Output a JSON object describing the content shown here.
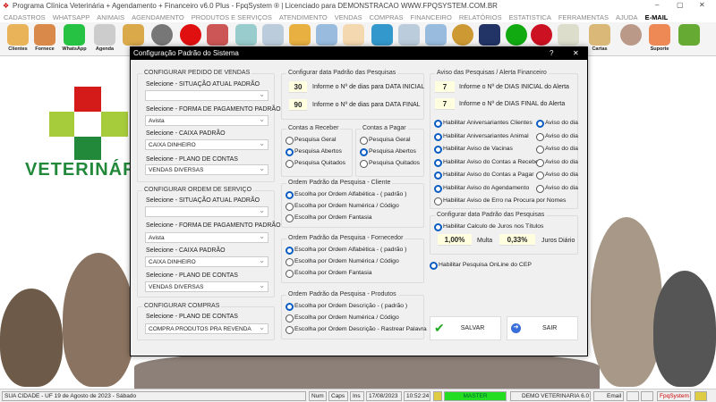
{
  "window": {
    "title": "Programa Clínica Veterinária + Agendamento + Financeiro v6.0 Plus - FpqSystem ® | Licenciado para  DEMONSTRACAO WWW.FPQSYSTEM.COM.BR",
    "minimize": "–",
    "maximize": "▢",
    "close": "✕"
  },
  "menu": [
    "CADASTROS",
    "WHATSAPP",
    "ANIMAIS",
    "AGENDAMENTO",
    "PRODUTOS E SERVIÇOS",
    "ATENDIMENTO",
    "VENDAS",
    "COMPRAS",
    "FINANCEIRO",
    "RELATÓRIOS",
    "ESTATISTICA",
    "FERRAMENTAS",
    "AJUDA",
    "E-MAIL"
  ],
  "toolbar": {
    "clientes": "Clientes",
    "fornece": "Fornece",
    "whatsapp": "WhatsApp",
    "agenda": "Agenda",
    "produtos": "Pr",
    "cartas": "Cartas",
    "suporte": "Suporte"
  },
  "logo": {
    "text": "VETERINÁR"
  },
  "dialog": {
    "title": "Configuração Padrão do Sistema",
    "help": "?",
    "close": "✕",
    "pedido": {
      "title": "CONFIGURAR PEDIDO DE VENDAS",
      "sit_label": "Selecione - SITUAÇÃO ATUAL PADRÃO",
      "sit_value": "",
      "pag_label": "Selecione - FORMA DE PAGAMENTO PADRÃO",
      "pag_value": "Avista",
      "caixa_label": "Selecione - CAIXA PADRÃO",
      "caixa_value": "CAIXA DINHEIRO",
      "plano_label": "Selecione - PLANO DE CONTAS",
      "plano_value": "VENDAS DIVERSAS"
    },
    "os": {
      "title": "CONFIGURAR ORDEM DE SERVIÇO",
      "sit_label": "Selecione - SITUAÇÃO ATUAL PADRÃO",
      "sit_value": "",
      "pag_label": "Selecione - FORMA DE PAGAMENTO PADRÃO",
      "pag_value": "Avista",
      "caixa_label": "Selecione - CAIXA PADRÃO",
      "caixa_value": "CAIXA DINHEIRO",
      "plano_label": "Selecione - PLANO DE CONTAS",
      "plano_value": "VENDAS DIVERSAS"
    },
    "compras": {
      "title": "CONFIGURAR COMPRAS",
      "plano_label": "Selecione - PLANO DE CONTAS",
      "plano_value": "COMPRA PRODUTOS PRA REVENDA"
    },
    "datas": {
      "title": "Configurar data Padrão das Pesquisas",
      "inicial": "30",
      "inicial_label": "Informe o Nº de dias para DATA INICIAL",
      "final": "90",
      "final_label": "Informe o Nº de dias para DATA FINAL"
    },
    "receber": {
      "title": "Contas a Receber",
      "options": [
        "Pesquisa Geral",
        "Pesquisa Abertos",
        "Pesquisa Quitados"
      ],
      "selected": 1
    },
    "pagar": {
      "title": "Contas a Pagar",
      "options": [
        "Pesquisa Geral",
        "Pesquisa Abertos",
        "Pesquisa Quitados"
      ],
      "selected": 1
    },
    "cliente": {
      "title": "Ordem Padrão da Pesquisa - Cliente",
      "options": [
        "Escolha por Ordem Alfabética - ( padrão )",
        "Escolha por Ordem Numérica / Código",
        "Escolha por Ordem Fantasia"
      ],
      "selected": 0
    },
    "fornecedor": {
      "title": "Ordem Padrão da Pesquisa - Fornecedor",
      "options": [
        "Escolha por Ordem Alfabética - ( padrão )",
        "Escolha por Ordem Numérica / Código",
        "Escolha por Ordem Fantasia"
      ],
      "selected": 0
    },
    "produtos": {
      "title": "Ordem Padrão da Pesquisa - Produtos",
      "options": [
        "Escolha por Ordem Descrição - ( padrão )",
        "Escolha por Ordem Numérica / Código",
        "Escolha por Ordem Descrição - Rastrear Palavra"
      ],
      "selected": 0
    },
    "aviso": {
      "title": "Aviso das Pesquisas / Alerta Financeiro",
      "dias_inicial": "7",
      "dias_inicial_label": "Informe o Nº de DIAS INICIAL do Alerta",
      "dias_final": "7",
      "dias_final_label": "Informe o Nº de DIAS FINAL do Alerta",
      "items": [
        {
          "label": "Habilitar Aniversariantes Clientes",
          "on": true,
          "dia": true
        },
        {
          "label": "Habilitar Aniversariantes Animal",
          "on": true,
          "dia": false
        },
        {
          "label": "Habilitar Aviso de Vacinas",
          "on": true,
          "dia": false
        },
        {
          "label": "Habilitar Aviso do Contas a Receber",
          "on": true,
          "dia": false
        },
        {
          "label": "Habilitar Aviso do Contas a Pagar",
          "on": true,
          "dia": false
        },
        {
          "label": "Habilitar Aviso do Agendamento",
          "on": true,
          "dia": false
        },
        {
          "label": "Habilitar Aviso de Erro na Procura por Nomes",
          "on": false
        }
      ],
      "dia_label": "Aviso do dia"
    },
    "juros": {
      "title": "Configurar data Padrão das Pesquisas",
      "habilitar": "Habilitar Calculo de Juros nos Títulos",
      "multa": "1,00%",
      "multa_label": "Multa",
      "juros": "0,33%",
      "juros_label": "Juros Diário"
    },
    "cep": "Habilitar Pesquisa OnLine do CEP",
    "salvar": "SALVAR",
    "sair": "SAIR"
  },
  "status": {
    "city": "SUA CIDADE - UF 19 de Agosto de 2023 - Sábado",
    "num": "Num",
    "caps": "Caps",
    "ins": "Ins",
    "date": "17/08/2023",
    "time": "10:52:24",
    "user": "MASTER",
    "db": "DEMO VETERINARIA 6.0",
    "email": "Email",
    "brand": "FpqSystem"
  },
  "colors": {
    "accent": "#0a5cc2",
    "master": "#22dd22",
    "brand": "#cc0000"
  }
}
